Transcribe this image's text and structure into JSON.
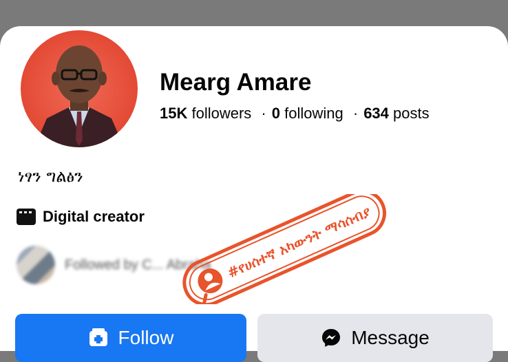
{
  "profile": {
    "name": "Mearg Amare",
    "followers_count": "15K",
    "followers_label": "followers",
    "following_count": "0",
    "following_label": "following",
    "posts_count": "634",
    "posts_label": "posts",
    "separator": "·",
    "bio": "ነፃን ግልፅን",
    "category": "Digital creator",
    "category_icon": "clapperboard-icon"
  },
  "mutual": {
    "text": "Followed by C... Abraha"
  },
  "actions": {
    "follow_label": "Follow",
    "follow_icon": "add-friend-icon",
    "message_label": "Message",
    "message_icon": "messenger-icon"
  },
  "watermark": {
    "text": "#የሀሰተኛ አካውንት ማሳሰብያ",
    "overlay_text": "Abraha",
    "color": "#e8542c"
  },
  "colors": {
    "primary": "#1877f2",
    "secondary_button": "#e4e6eb"
  }
}
